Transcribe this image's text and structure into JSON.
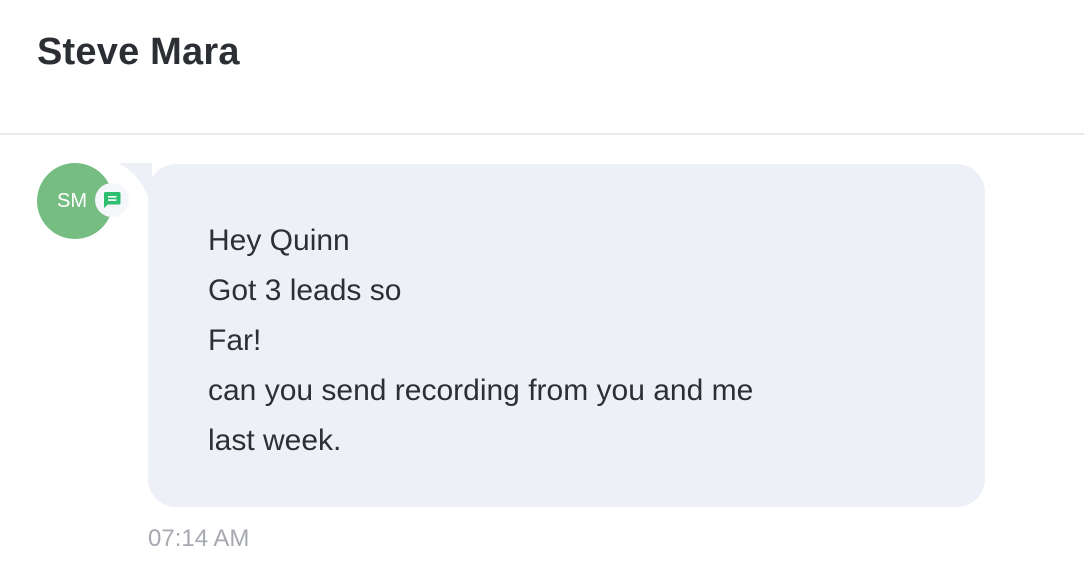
{
  "header": {
    "contact_name": "Steve Mara"
  },
  "message": {
    "avatar_initials": "SM",
    "avatar_color": "#76bd82",
    "channel_icon": "sms-chat-icon",
    "channel_icon_color": "#2fbf71",
    "bubble_color": "#eef0f8",
    "lines": [
      "Hey Quinn",
      "Got 3 leads so",
      "Far!",
      "can you send recording from you and me",
      "last week."
    ],
    "timestamp": "07:14 AM"
  }
}
